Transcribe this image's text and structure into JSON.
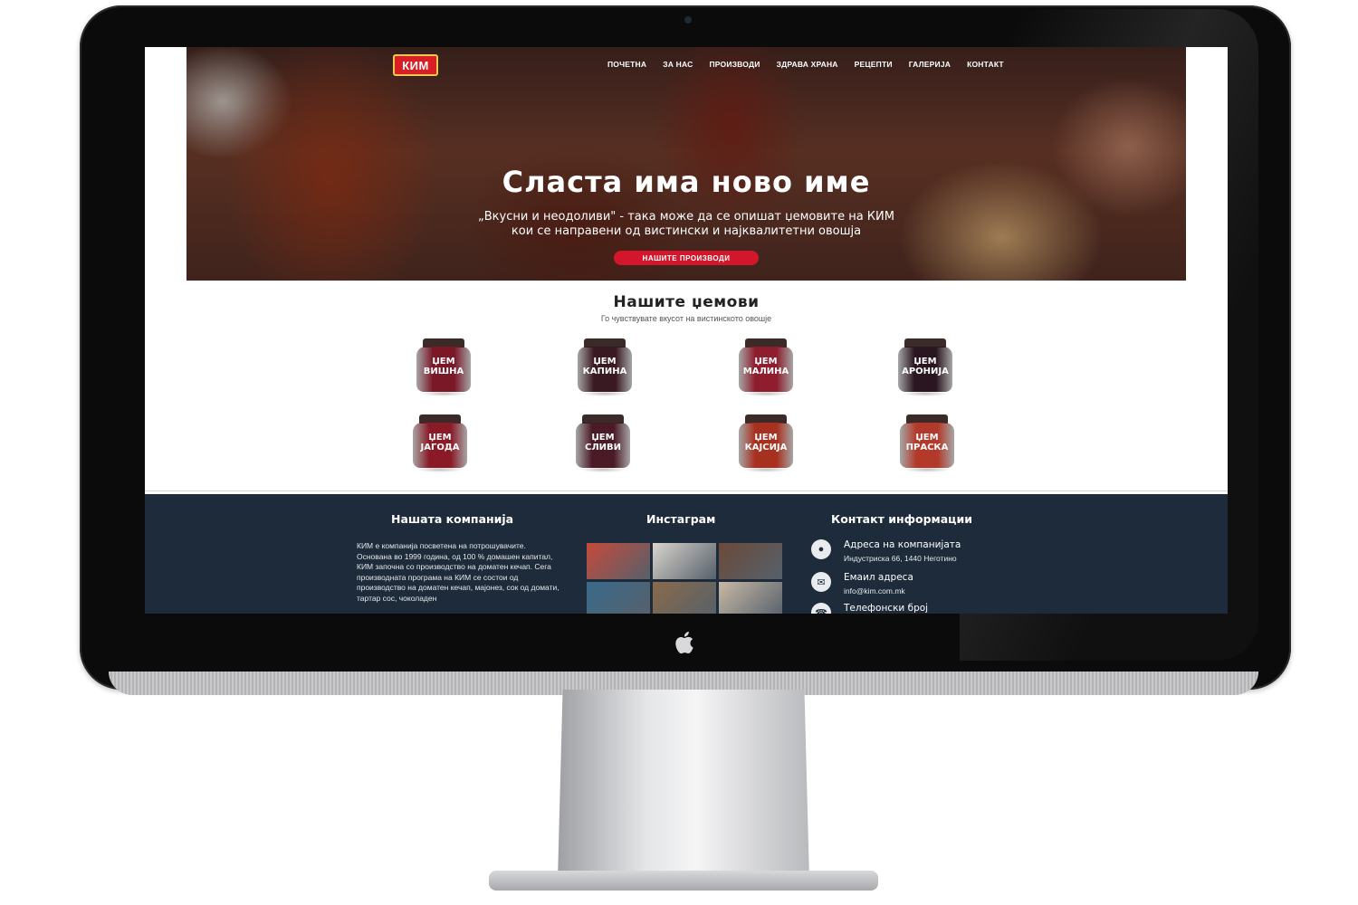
{
  "nav": {
    "logo": "КИМ",
    "items": [
      "ПОЧЕТНА",
      "ЗА НАС",
      "ПРОИЗВОДИ",
      "ЗДРАВА ХРАНА",
      "РЕЦЕПТИ",
      "ГАЛЕРИЈА",
      "КОНТАКТ"
    ]
  },
  "hero": {
    "title": "Сласта има ново име",
    "text": "„Вкусни и неодоливи\" - така може да се опишат џемовите на КИМ кои се направени од вистински и најквалитетни овошја",
    "button": "НАШИТЕ ПРОИЗВОДИ"
  },
  "products": {
    "title": "Нашите џемови",
    "subtitle": "Го чувствувате вкусот на вистинското овошје",
    "items": [
      {
        "label": "ЏЕМ ВИШНА",
        "color": "#7a1828"
      },
      {
        "label": "ЏЕМ КАПИНА",
        "color": "#3a1a22"
      },
      {
        "label": "ЏЕМ МАЛИНА",
        "color": "#8e1e2e"
      },
      {
        "label": "ЏЕМ АРОНИЈА",
        "color": "#2a1620"
      },
      {
        "label": "ЏЕМ ЈАГОДА",
        "color": "#8a1a26"
      },
      {
        "label": "ЏЕМ СЛИВИ",
        "color": "#4a1a26"
      },
      {
        "label": "ЏЕМ КАЈСИЈА",
        "color": "#a8301e"
      },
      {
        "label": "ЏЕМ ПРАСКА",
        "color": "#b33a2a"
      }
    ]
  },
  "footer": {
    "company_title": "Нашата компанија",
    "company_text": "КИМ е компанија посветена на потрошувачите. Основана во 1999 година, од 100 % домашен капитал, КИМ започна со производство на доматен кечап. Сега производната програма на КИМ се состои од производство на доматен кечап, мајонез, сок од домати, тартар сос, чоколаден",
    "instagram_title": "Инстаграм",
    "instagram_tiles": [
      "#c64a3a",
      "#d9d4cc",
      "#6b4a3a",
      "#3a6a8a",
      "#8a6a4a",
      "#c7b8a4",
      "#d8d8d6",
      "#e07a2a",
      "#b8c4c8"
    ],
    "contact_title": "Контакт информации",
    "address_label": "Адреса на компанијата",
    "address_value": "Индустриска 66, 1440 Неготино",
    "email_label": "Емаил адреса",
    "email_value": "info@kim.com.mk",
    "phone_label": "Телефонски број"
  }
}
